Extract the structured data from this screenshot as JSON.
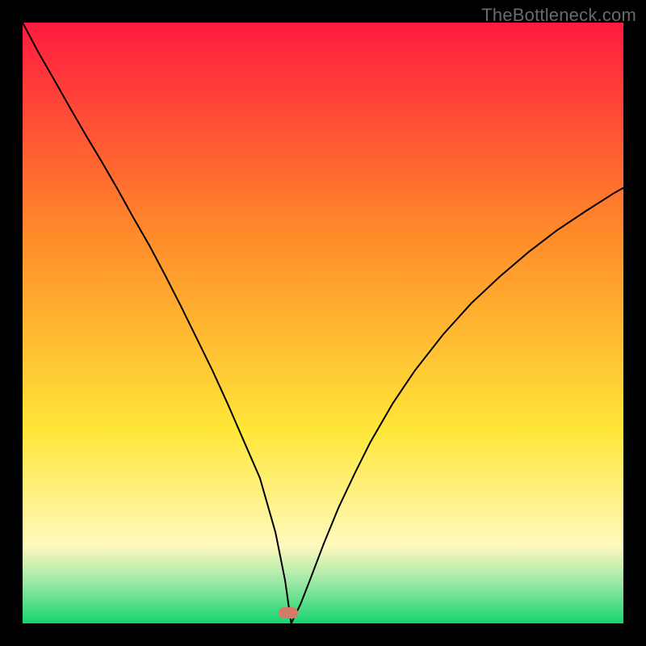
{
  "watermark": "TheBottleneck.com",
  "colors": {
    "frame": "#000000",
    "red": "#ff1a3f",
    "orange": "#ff8a2a",
    "yellow": "#ffe739",
    "paleYellow": "#fff9bd",
    "lightGreen": "#9fe9a8",
    "green": "#16d46e",
    "curve": "#000000",
    "marker": "#d37b6b",
    "watermark": "#6a6a6a"
  },
  "marker": {
    "x_pct": 44.2,
    "y_pct": 98.3
  },
  "chart_data": {
    "type": "line",
    "title": "",
    "xlabel": "",
    "ylabel": "",
    "xlim": [
      0,
      100
    ],
    "ylim": [
      0,
      100
    ],
    "grid": false,
    "legend": false,
    "series": [
      {
        "name": "bottleneck-curve",
        "x": [
          0.0,
          2.6,
          5.3,
          7.9,
          10.5,
          13.2,
          15.8,
          18.4,
          21.1,
          23.7,
          26.3,
          28.9,
          31.6,
          34.2,
          36.8,
          39.5,
          42.1,
          43.7,
          44.7,
          46.3,
          47.9,
          50.1,
          52.6,
          55.3,
          57.9,
          61.6,
          65.3,
          70.0,
          74.7,
          79.5,
          84.2,
          88.9,
          93.7,
          98.4,
          100.0
        ],
        "y": [
          100.0,
          95.1,
          90.4,
          85.8,
          81.3,
          76.8,
          72.3,
          67.6,
          62.9,
          58.0,
          52.9,
          47.6,
          42.1,
          36.4,
          30.4,
          24.2,
          15.1,
          7.1,
          0.0,
          3.3,
          7.4,
          13.2,
          19.3,
          25.0,
          30.2,
          36.6,
          42.1,
          48.1,
          53.3,
          57.8,
          61.8,
          65.4,
          68.6,
          71.6,
          72.5
        ]
      }
    ],
    "annotations": [
      {
        "type": "marker",
        "x": 44.2,
        "y": 1.7,
        "label": "minimum"
      }
    ],
    "background_gradient_stops": [
      {
        "pct": 0,
        "color": "#ff1a3f"
      },
      {
        "pct": 35,
        "color": "#ff8a2a"
      },
      {
        "pct": 68,
        "color": "#ffe739"
      },
      {
        "pct": 87,
        "color": "#fff9bd"
      },
      {
        "pct": 93,
        "color": "#9fe9a8"
      },
      {
        "pct": 100,
        "color": "#16d46e"
      }
    ]
  }
}
